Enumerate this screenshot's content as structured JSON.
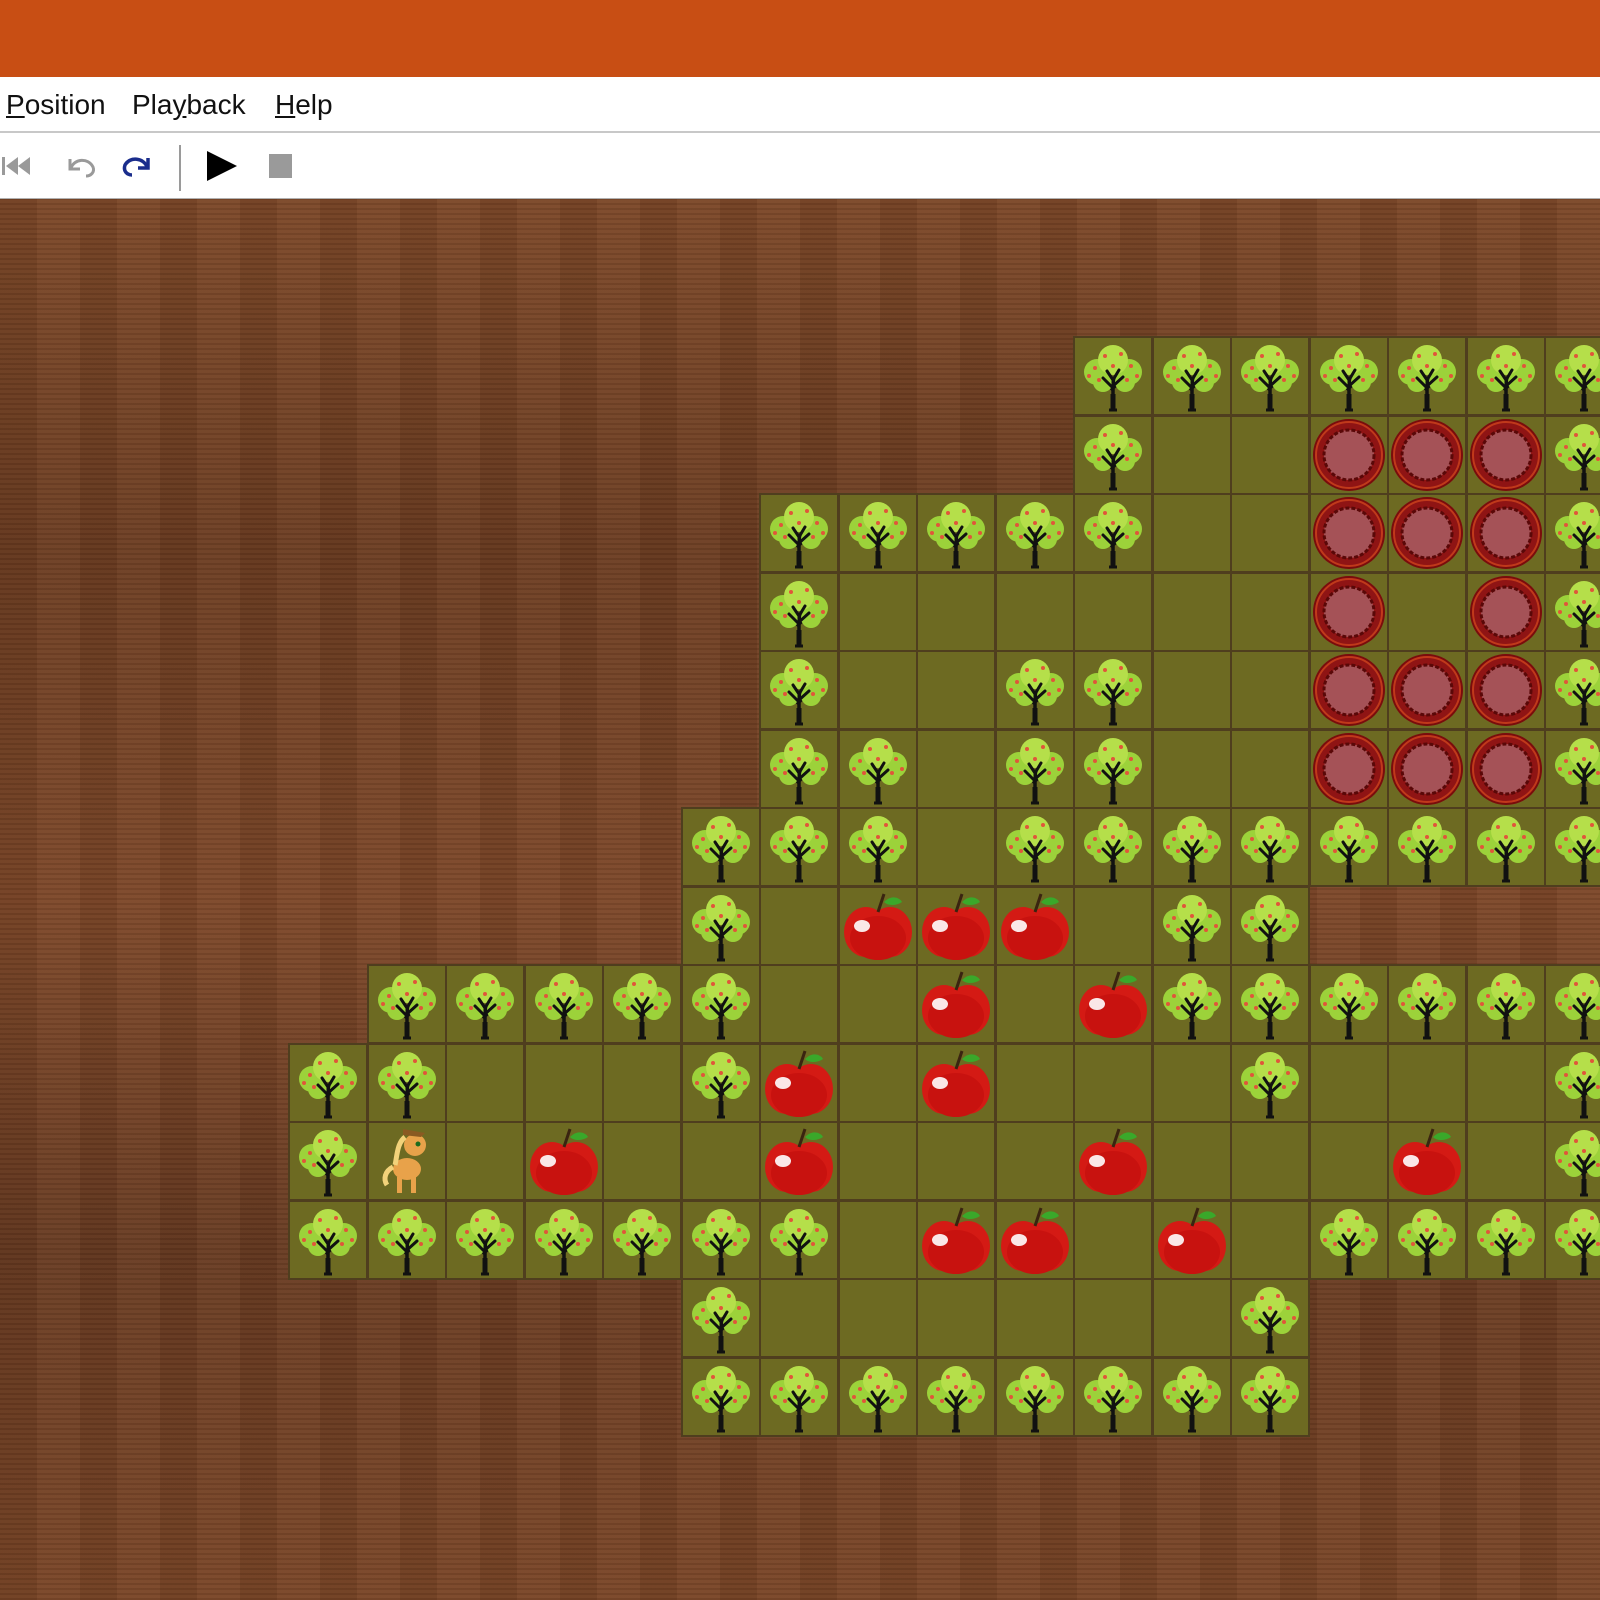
{
  "menu": {
    "items": [
      {
        "name": "menu-position",
        "mnemonic": "P",
        "rest": "osition"
      },
      {
        "name": "menu-playback",
        "prefix": "Pla",
        "mnemonic": "y",
        "rest": "back"
      },
      {
        "name": "menu-help",
        "mnemonic": "H",
        "rest": "elp"
      }
    ]
  },
  "toolbar": {
    "buttons": [
      {
        "name": "rewind-to-start-button",
        "icon": "rewind-start-icon",
        "enabled": false
      },
      {
        "name": "undo-button",
        "icon": "undo-icon",
        "enabled": false
      },
      {
        "name": "redo-button",
        "icon": "redo-icon",
        "enabled": true
      },
      {
        "name": "play-button",
        "icon": "play-icon",
        "enabled": true
      },
      {
        "name": "stop-button",
        "icon": "stop-icon",
        "enabled": false
      }
    ]
  },
  "colors": {
    "titlebar": "#c84e14",
    "floor": "#6d6a22",
    "grid_line": "#4f3e1e",
    "background_wood": "#6e3f22",
    "redo_icon": "#1a2d8c"
  },
  "board": {
    "legend": {
      "T": "apple-tree-wall",
      "F": "floor",
      "G": "goal-target",
      "A": "apple-box",
      "P": "pony-player"
    },
    "rows": [
      ".............TTTTTTT",
      ".............TFFGGGT",
      ".........TTTTTFFGGGT",
      ".........TFFFFFFGFGT",
      ".........TFFTTFFGGGT",
      ".........TTFTTFFGGGT",
      "........TTTFTTTTTTTT",
      "........TFAAAFTT....",
      "....TTTTTFFAFATTTTTT",
      "...TTFFFTAFAFFFTFFFT",
      "...TPFAFFAFFFAFFFAFT",
      "...TTTTTTTFAAFAFTTTTT",
      "........TFFFFFFT....",
      "........TTTTTTTT...."
    ]
  }
}
